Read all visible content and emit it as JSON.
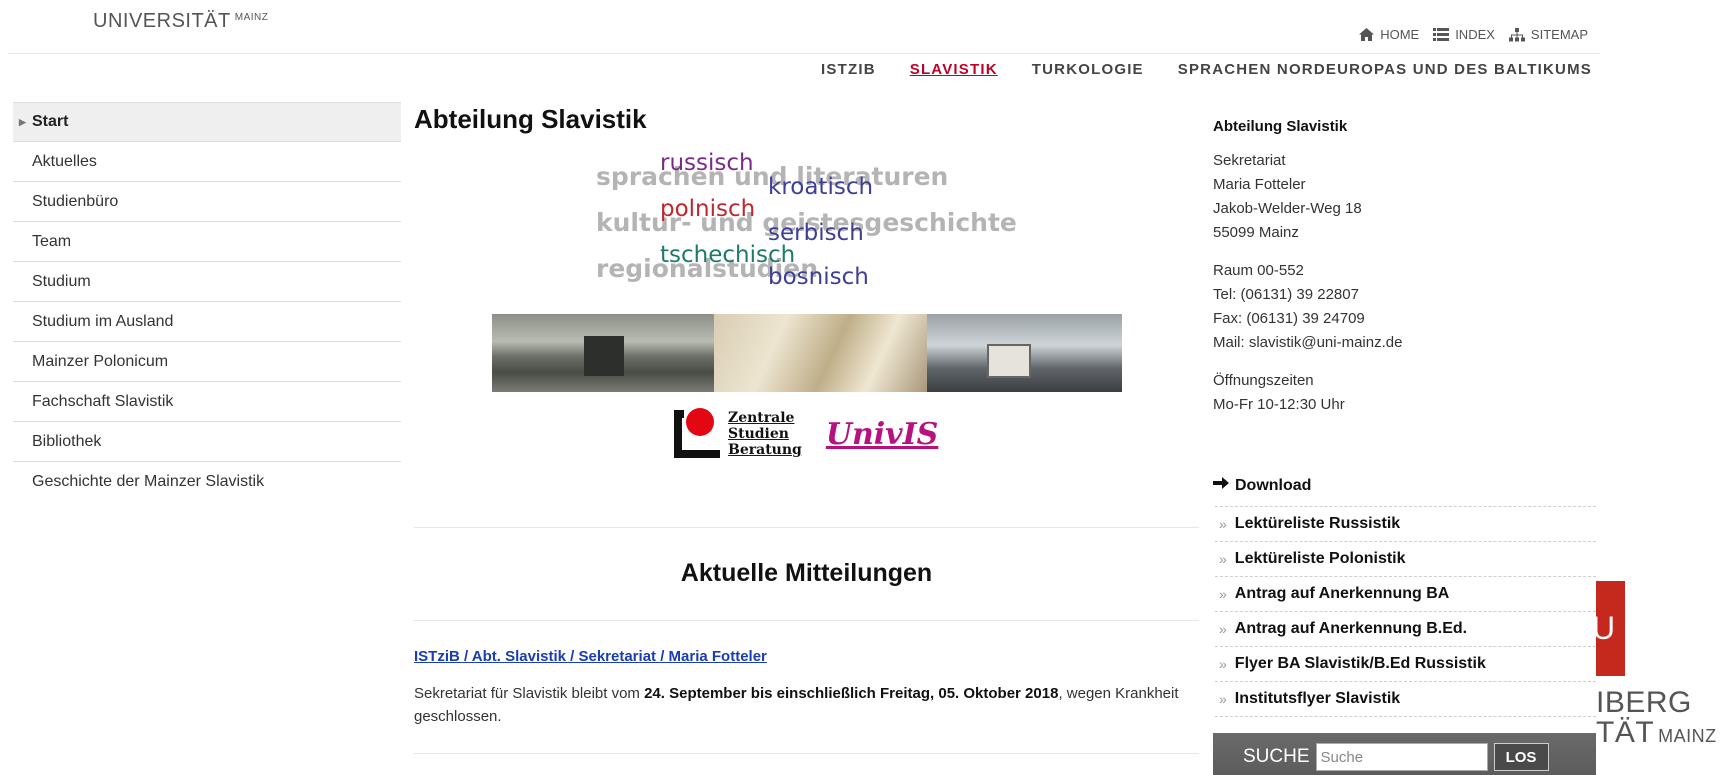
{
  "header": {
    "logo_main": "UNIVERSITÄT",
    "logo_sup": "MAINZ",
    "service_nav": [
      {
        "label": "HOME",
        "icon": "home-icon"
      },
      {
        "label": "INDEX",
        "icon": "list-icon"
      },
      {
        "label": "SITEMAP",
        "icon": "sitemap-icon"
      }
    ],
    "main_nav": [
      {
        "label": "ISTZIB"
      },
      {
        "label": "SLAVISTIK",
        "active": true
      },
      {
        "label": "TURKOLOGIE"
      },
      {
        "label": "SPRACHEN NORDEUROPAS UND DES BALTIKUMS"
      }
    ]
  },
  "sidebar": {
    "items": [
      {
        "label": "Start",
        "active": true
      },
      {
        "label": "Aktuelles"
      },
      {
        "label": "Studienbüro"
      },
      {
        "label": "Team"
      },
      {
        "label": "Studium"
      },
      {
        "label": "Studium im Ausland"
      },
      {
        "label": "Mainzer Polonicum"
      },
      {
        "label": "Fachschaft Slavistik"
      },
      {
        "label": "Bibliothek"
      },
      {
        "label": "Geschichte der Mainzer Slavistik"
      }
    ]
  },
  "main": {
    "title": "Abteilung Slavistik",
    "wordcloud": {
      "grey": [
        "sprachen und literaturen",
        "kultur- und geistesgeschichte",
        "regionalstudien"
      ],
      "languages": [
        {
          "text": "russisch",
          "color": "#7b2a8a"
        },
        {
          "text": "kroatisch",
          "color": "#3d3f96"
        },
        {
          "text": "polnisch",
          "color": "#c0262d"
        },
        {
          "text": "serbisch",
          "color": "#3d3f96"
        },
        {
          "text": "tschechisch",
          "color": "#1f7a6a"
        },
        {
          "text": "bosnisch",
          "color": "#3d3f96"
        }
      ]
    },
    "zsb_logo": [
      "Zentrale",
      "Studien",
      "Beratung"
    ],
    "univis_logo": "UnivIS",
    "news_section_title": "Aktuelle Mitteilungen",
    "news": {
      "author": "ISTziB / Abt. Slavistik / Sekretariat / Maria Fotteler",
      "text_before": "Sekretariat für Slavistik bleibt vom ",
      "text_bold": "24. September bis einschließlich Freitag, 05. Oktober 2018",
      "text_after": ", wegen Krankheit geschlossen."
    }
  },
  "right": {
    "heading": "Abteilung Slavistik",
    "address": [
      "Sekretariat",
      "Maria Fotteler",
      "Jakob-Welder-Weg 18",
      "55099 Mainz"
    ],
    "contact": [
      "Raum 00-552",
      "Tel: (06131) 39 22807",
      "Fax: (06131) 39 24709",
      "Mail: slavistik@uni-mainz.de"
    ],
    "hours": [
      "Öffnungszeiten",
      "Mo-Fr 10-12:30 Uhr"
    ],
    "download_title": "Download",
    "downloads": [
      "Lektüreliste Russistik",
      "Lektüreliste Polonistik",
      "Antrag auf Anerkennung BA",
      "Antrag auf Anerkennung B.Ed.",
      "Flyer BA Slavistik/B.Ed Russistik",
      "Institutsflyer Slavistik"
    ]
  },
  "search": {
    "label": "SUCHE",
    "placeholder": "Suche",
    "button": "LOS"
  },
  "jgu_logo": {
    "box_text": "U",
    "line1": "IBERG",
    "line2": "TÄT",
    "line2_sup": "MAINZ"
  },
  "colors": {
    "active_nav": "#c1002a",
    "news_author": "#1a3db3",
    "univis": "#b5117f",
    "jgu_red": "#c5281c"
  }
}
